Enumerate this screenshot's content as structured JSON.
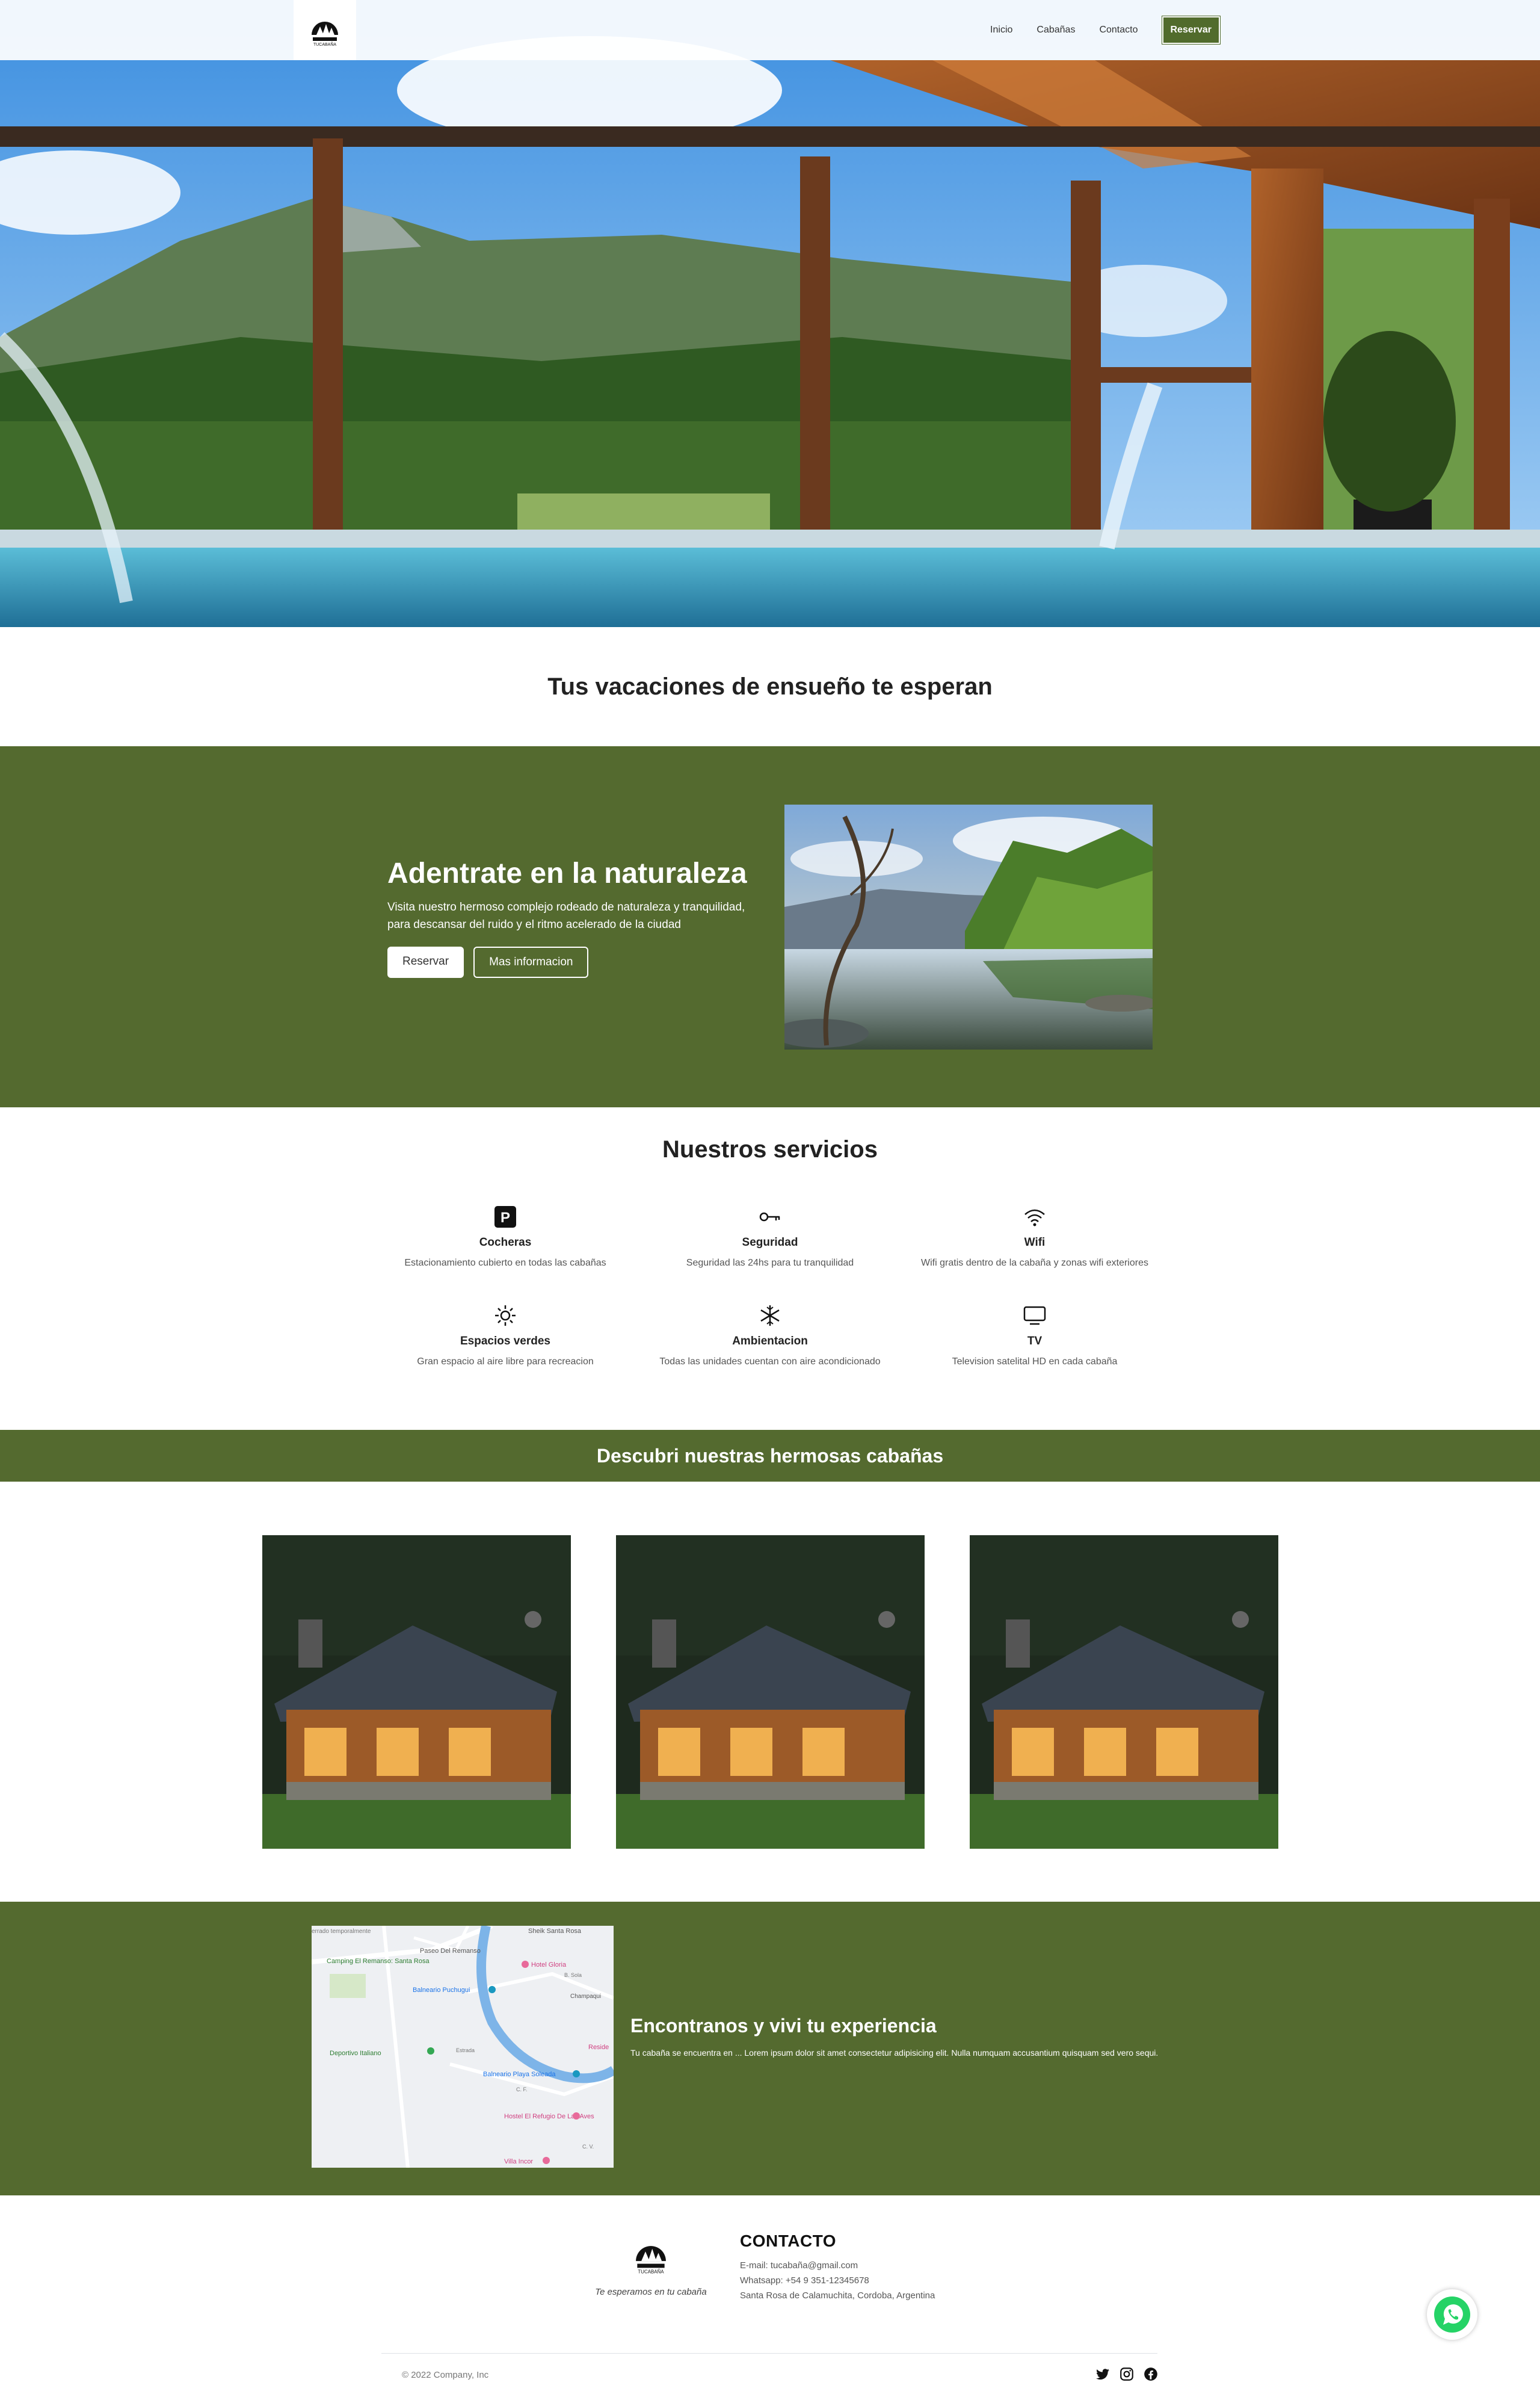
{
  "nav": {
    "links": [
      "Inicio",
      "Cabañas",
      "Contacto"
    ],
    "reserve": "Reservar",
    "logo_text": "TUCABAÑA"
  },
  "tagline": "Tus vacaciones de ensueño te esperan",
  "nature": {
    "title": "Adentrate en la naturaleza",
    "text": "Visita nuestro hermoso complejo rodeado de naturaleza y tranquilidad, para descansar del ruido y el ritmo acelerado de la ciudad",
    "btn_primary": "Reservar",
    "btn_secondary": "Mas informacion"
  },
  "services": {
    "title": "Nuestros servicios",
    "items": [
      {
        "icon": "parking-icon",
        "name": "Cocheras",
        "desc": "Estacionamiento cubierto en todas las cabañas"
      },
      {
        "icon": "key-icon",
        "name": "Seguridad",
        "desc": "Seguridad las 24hs para tu tranquilidad"
      },
      {
        "icon": "wifi-icon",
        "name": "Wifi",
        "desc": "Wifi gratis dentro de la cabaña y zonas wifi exteriores"
      },
      {
        "icon": "sun-icon",
        "name": "Espacios verdes",
        "desc": "Gran espacio al aire libre para recreacion"
      },
      {
        "icon": "snowflake-icon",
        "name": "Ambientacion",
        "desc": "Todas las unidades cuentan con aire acondicionado"
      },
      {
        "icon": "tv-icon",
        "name": "TV",
        "desc": "Television satelital HD en cada cabaña"
      }
    ]
  },
  "cabins": {
    "title": "Descubri nuestras hermosas cabañas",
    "count": 3
  },
  "map": {
    "labels": {
      "sheik": "Sheik Santa Rosa",
      "paseo": "Paseo Del Remanso",
      "camping": "Camping El Remanso: Santa Rosa",
      "hotel": "Hotel Gloria",
      "balneario": "Balneario Puchugui",
      "deportivo": "Deportivo Italiano",
      "playa": "Balneario Playa Soleada",
      "hostel": "Hostel El Refugio De Las Aves",
      "villa": "Villa Incor",
      "champaqui": "Champaqui",
      "resid": "Reside",
      "closed": "errado temporalmente",
      "street1": "B. Sola",
      "street2": "Estrada",
      "street3": "C. F.",
      "street4": "C. V."
    },
    "title": "Encontranos y vivi tu experiencia",
    "text": "Tu cabaña se encuentra en ... Lorem ipsum dolor sit amet consectetur adipisicing elit. Nulla numquam accusantium quisquam sed vero sequi."
  },
  "footer": {
    "slogan": "Te esperamos en tu cabaña",
    "contact_title": "CONTACTO",
    "email": "E-mail: tucabaña@gmail.com",
    "whatsapp": "Whatsapp: +54 9 351-12345678",
    "address": "Santa Rosa de Calamuchita, Cordoba, Argentina",
    "copyright": "© 2022 Company, Inc",
    "socials": [
      "twitter-icon",
      "instagram-icon",
      "facebook-icon"
    ]
  },
  "colors": {
    "brand_green": "#546a2f",
    "white": "#ffffff"
  }
}
